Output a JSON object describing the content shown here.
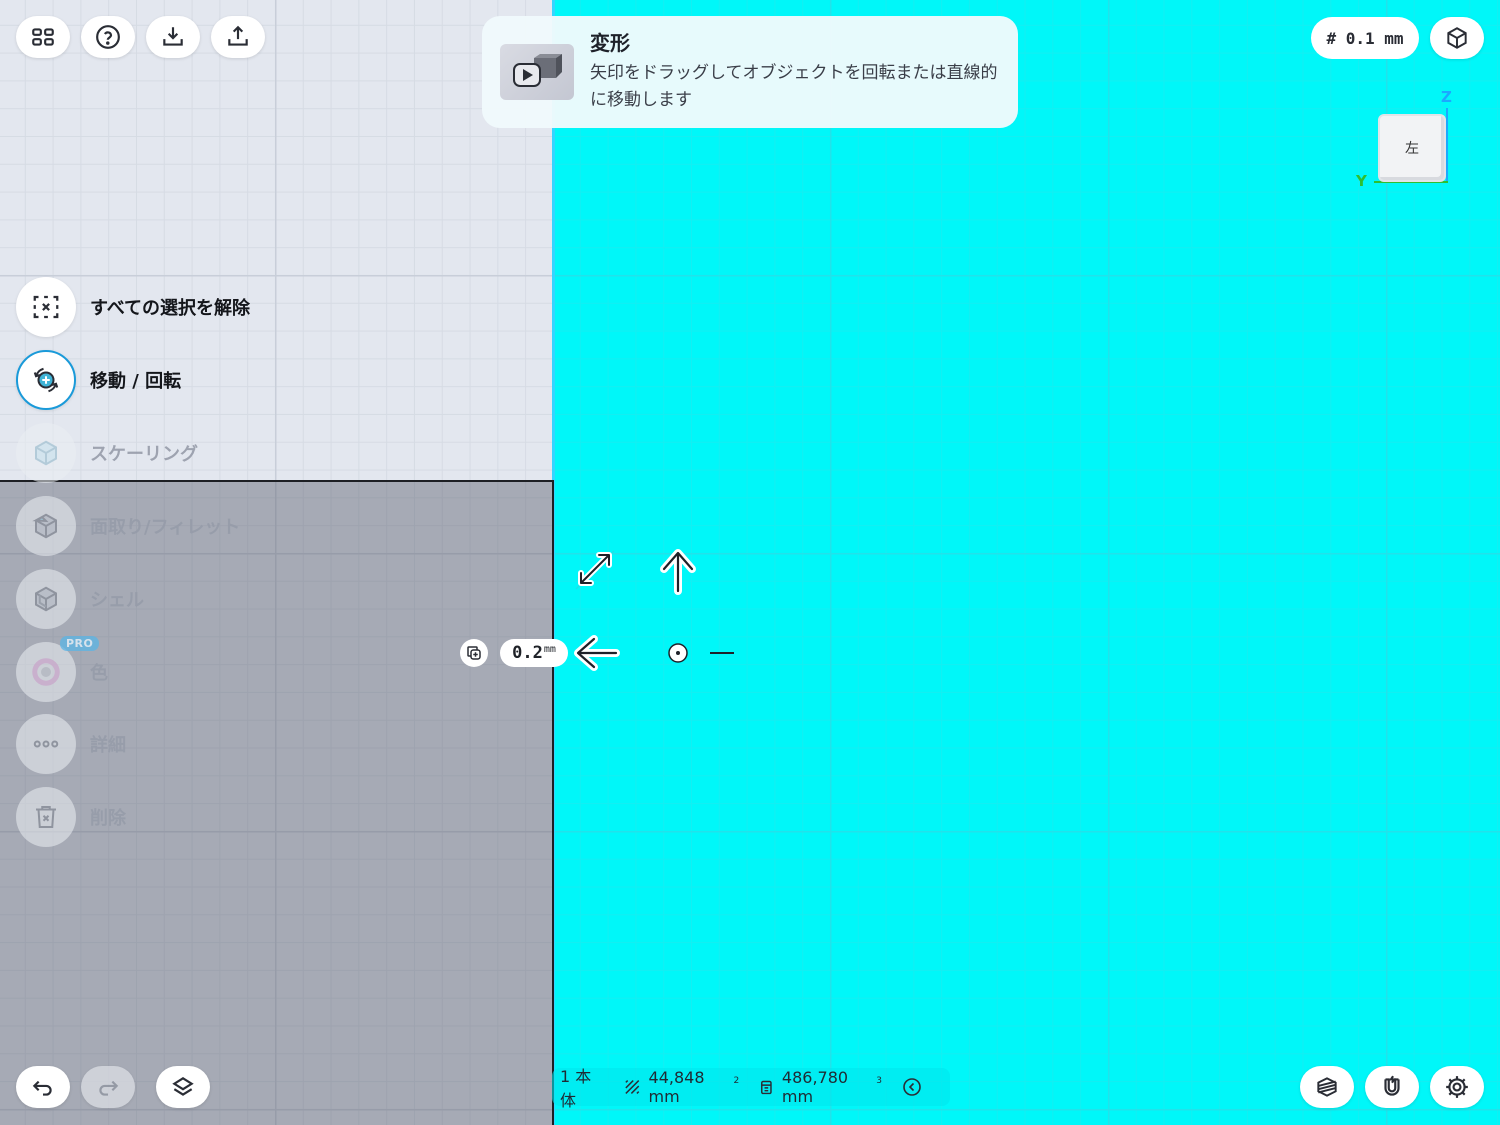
{
  "toolbar_top_left": {
    "items": [
      {
        "name": "grid-menu",
        "icon": "grid-icon"
      },
      {
        "name": "help",
        "icon": "help-icon"
      },
      {
        "name": "import",
        "icon": "download-icon"
      },
      {
        "name": "export",
        "icon": "share-icon"
      }
    ]
  },
  "tooltip": {
    "title": "変形",
    "description": "矢印をドラッグしてオブジェクトを回転または直線的に移動します"
  },
  "top_right": {
    "grid_size_label": "# 0.1 mm",
    "view_button_icon": "view-cube-icon",
    "view_cube_face": "左",
    "axis_z": "Z",
    "axis_y": "Y"
  },
  "side_menu": {
    "items": [
      {
        "label": "すべての選択を解除",
        "icon": "deselect-icon",
        "state": "normal"
      },
      {
        "label": "移動 / 回転",
        "icon": "move-rotate-icon",
        "state": "active"
      },
      {
        "label": "スケーリング",
        "icon": "scale-icon",
        "state": "disabled"
      },
      {
        "label": "面取り/フィレット",
        "icon": "chamfer-icon",
        "state": "disabled"
      },
      {
        "label": "シェル",
        "icon": "shell-icon",
        "state": "disabled"
      },
      {
        "label": "色",
        "icon": "color-icon",
        "state": "disabled",
        "badge": "PRO"
      },
      {
        "label": "詳細",
        "icon": "more-icon",
        "state": "disabled"
      },
      {
        "label": "削除",
        "icon": "trash-icon",
        "state": "disabled"
      }
    ]
  },
  "gizmo": {
    "dimension_value": "0.2",
    "dimension_unit": "mm"
  },
  "status_bar": {
    "bodies": "1 本体",
    "area_value": "44,848 mm",
    "area_exp": "2",
    "volume_value": "486,780 mm",
    "volume_exp": "3"
  },
  "bottom_left": {
    "items": [
      {
        "name": "undo",
        "icon": "undo-icon"
      },
      {
        "name": "redo",
        "icon": "redo-icon"
      },
      {
        "name": "layers",
        "icon": "layers-icon"
      }
    ]
  },
  "bottom_right": {
    "items": [
      {
        "name": "section-view",
        "icon": "section-icon"
      },
      {
        "name": "snap",
        "icon": "magnet-icon"
      },
      {
        "name": "settings",
        "icon": "gear-icon"
      }
    ]
  },
  "colors": {
    "viewport_cyan": "#00f7f9",
    "viewport_grey": "#e3e7ef",
    "accent_blue": "#1a9ad9"
  }
}
